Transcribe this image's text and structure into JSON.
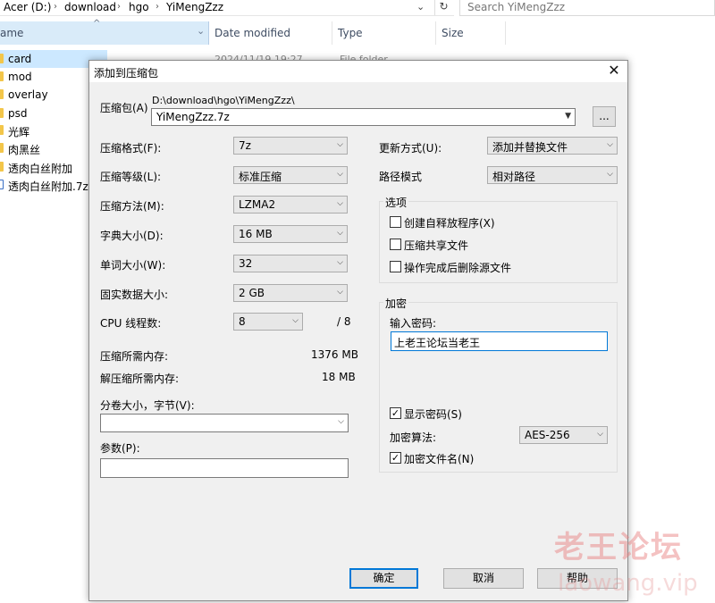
{
  "explorer": {
    "breadcrumb": [
      "Acer (D:)",
      "download",
      "hgo",
      "YiMengZzz"
    ],
    "search_placeholder": "Search YiMengZzz",
    "columns": {
      "name": "ame",
      "date": "Date modified",
      "type": "Type",
      "size": "Size"
    },
    "files": [
      "card",
      "mod",
      "overlay",
      "psd",
      "光辉",
      "肉黑丝",
      "透肉白丝附加",
      "透肉白丝附加.7z"
    ],
    "bg_row": {
      "date": "2024/11/19 19:27",
      "type": "File folder"
    }
  },
  "dialog": {
    "title": "添加到压缩包",
    "close_glyph": "✕",
    "archive_label": "压缩包(A)",
    "archive_path": "D:\\download\\hgo\\YiMengZzz\\",
    "archive_name": "YiMengZzz.7z",
    "browse_label": "...",
    "format_label": "压缩格式(F):",
    "format_value": "7z",
    "level_label": "压缩等级(L):",
    "level_value": "标准压缩",
    "method_label": "压缩方法(M):",
    "method_value": "LZMA2",
    "dict_label": "字典大小(D):",
    "dict_value": "16 MB",
    "word_label": "单词大小(W):",
    "word_value": "32",
    "solid_label": "固实数据大小:",
    "solid_value": "2 GB",
    "threads_label": "CPU 线程数:",
    "threads_value": "8",
    "threads_total": "/ 8",
    "mem_comp_label": "压缩所需内存:",
    "mem_comp_value": "1376 MB",
    "mem_decomp_label": "解压缩所需内存:",
    "mem_decomp_value": "18 MB",
    "split_label": "分卷大小，字节(V):",
    "split_value": "",
    "params_label": "参数(P):",
    "params_value": "",
    "update_label": "更新方式(U):",
    "update_value": "添加并替换文件",
    "pathmode_label": "路径模式",
    "pathmode_value": "相对路径",
    "options_title": "选项",
    "opt_sfx": "创建自释放程序(X)",
    "opt_shared": "压缩共享文件",
    "opt_delete": "操作完成后删除源文件",
    "enc_title": "加密",
    "pw_label": "输入密码:",
    "pw_value": "上老王论坛当老王",
    "show_pw": "显示密码(S)",
    "enc_method_label": "加密算法:",
    "enc_method_value": "AES-256",
    "enc_names": "加密文件名(N)",
    "check_mark": "✓",
    "ok": "确定",
    "cancel": "取消",
    "help": "帮助"
  },
  "watermark": {
    "text": "老王论坛",
    "url": "laowang.vip"
  }
}
